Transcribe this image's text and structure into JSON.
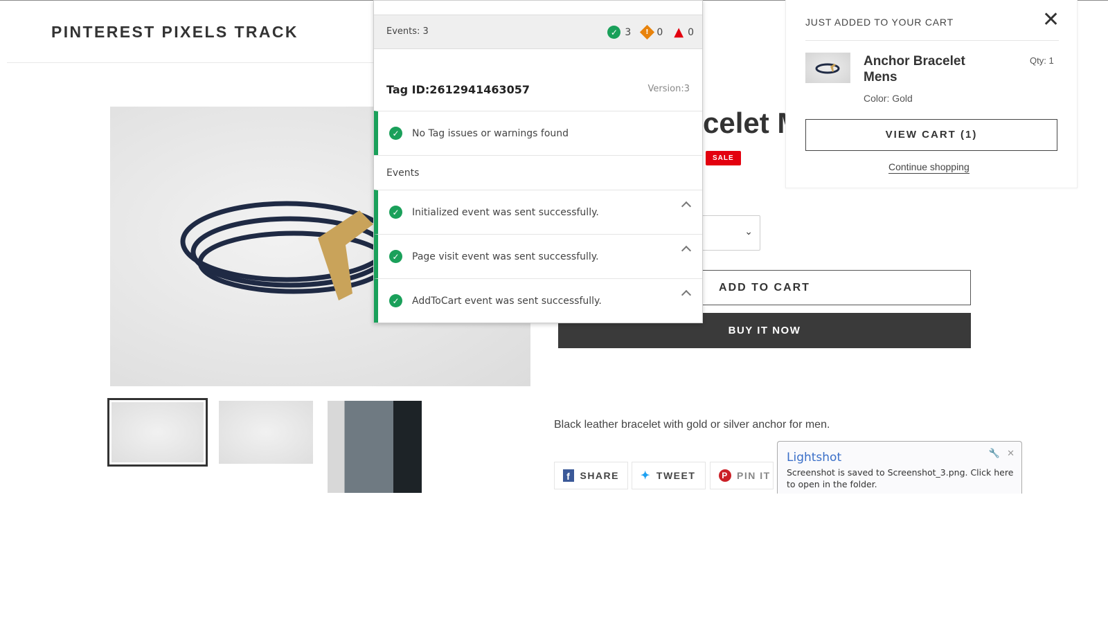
{
  "store": {
    "name": "PINTEREST PIXELS TRACK"
  },
  "product": {
    "title_visible": "celet M",
    "sale_badge": "SALE",
    "add_to_cart": "ADD TO CART",
    "buy_now": "BUY IT NOW",
    "description": "Black leather bracelet with gold or silver anchor for men.",
    "share": {
      "facebook": "SHARE",
      "twitter": "TWEET",
      "pinterest": "PIN IT"
    }
  },
  "tag_panel": {
    "events_label": "Events: 3",
    "counts": {
      "success": "3",
      "warning": "0",
      "error": "0"
    },
    "tag_id": "Tag ID:2612941463057",
    "version": "Version:3",
    "status": "No Tag issues or warnings found",
    "events_heading": "Events",
    "events": [
      {
        "label": "Initialized event was sent successfully."
      },
      {
        "label": "Page visit event was sent successfully."
      },
      {
        "label": "AddToCart event was sent successfully."
      }
    ],
    "colors": {
      "success": "#1aa05a",
      "warning": "#e8830c",
      "error": "#e3000f"
    }
  },
  "cart": {
    "heading": "JUST ADDED TO YOUR CART",
    "item_name": "Anchor Bracelet Mens",
    "qty": "Qty: 1",
    "color": "Color: Gold",
    "view_cart": "VIEW CART (1)",
    "continue": "Continue shopping"
  },
  "lightshot": {
    "title": "Lightshot",
    "message": "Screenshot is saved to Screenshot_3.png. Click here to open in the folder."
  }
}
